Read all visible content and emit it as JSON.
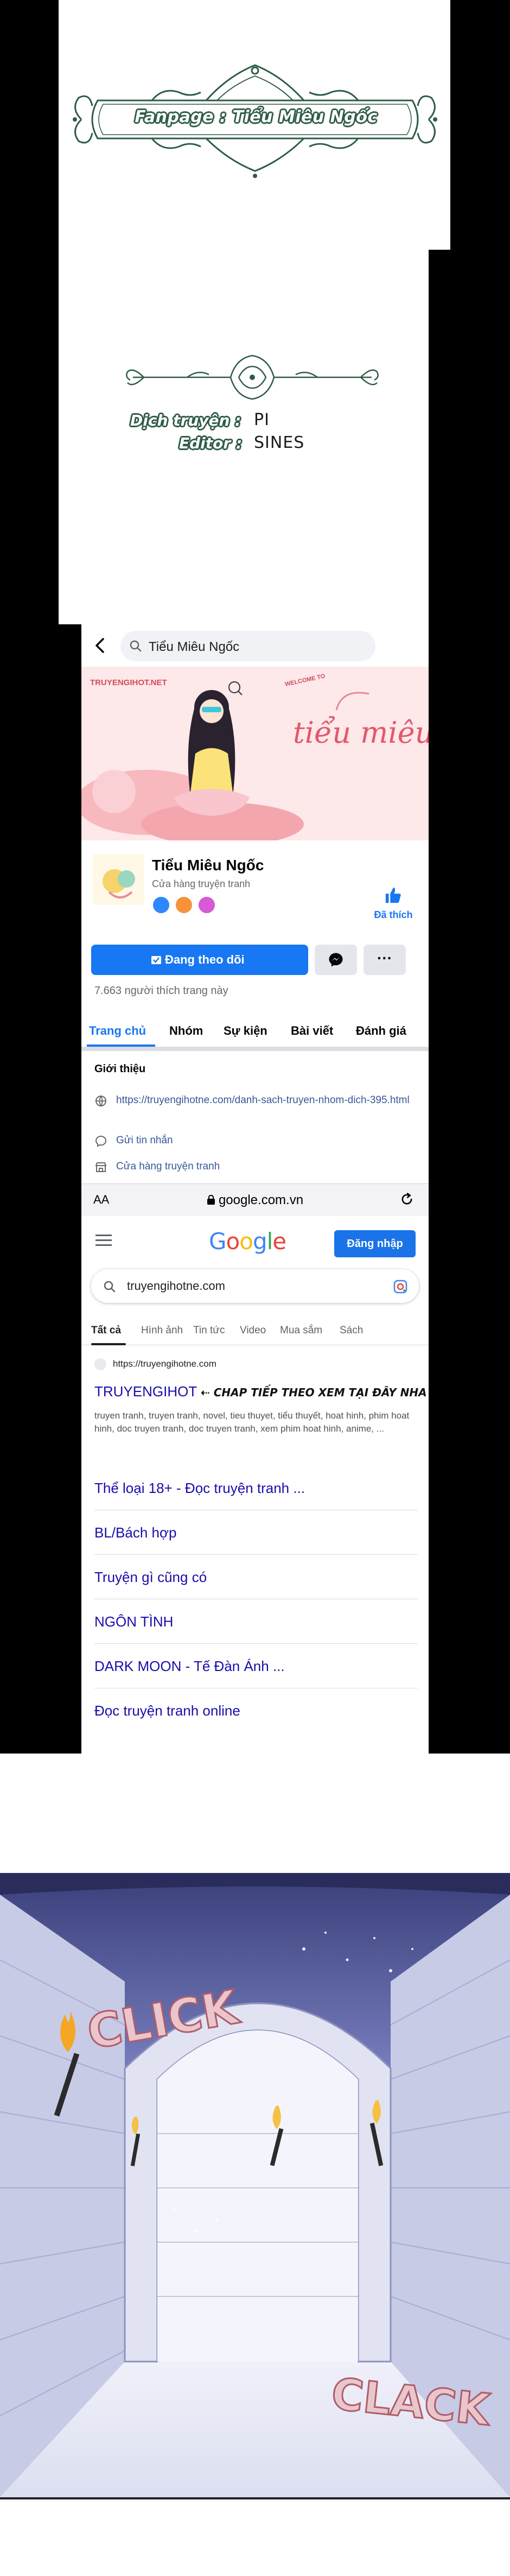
{
  "credits": {
    "fanpage_label": "Fanpage : Tiểu Miêu Ngốc",
    "translator_label": "Dịch truyện :",
    "translator_value": "PI",
    "editor_label": "Editor :",
    "editor_value": "SINES"
  },
  "facebook": {
    "search_query": "Tiểu Miêu Ngốc",
    "cover_brand": "TRUYENGIHOT.NET",
    "cover_welcome": "WELCOME TO",
    "cover_script": "tiểu miêu ngốc",
    "page_name": "Tiểu Miêu Ngốc",
    "page_category": "Cửa hàng truyện tranh",
    "liked_label": "Đã thích",
    "follow_label": "Đang theo dõi",
    "more_label": "···",
    "likes_count": "7.663 người thích trang này",
    "tabs": [
      "Trang chủ",
      "Nhóm",
      "Sự kiện",
      "Bài viết",
      "Đánh giá"
    ],
    "intro_title": "Giới thiệu",
    "intro_link": "https://truyengihotne.com/danh-sach-truyen-nhom-dich-395.html",
    "send_message": "Gửi tin nhắn",
    "shop_label": "Cửa hàng truyện tranh"
  },
  "safari": {
    "aa": "AA",
    "url": "google.com.vn",
    "lock_icon": "lock-icon",
    "reload_icon": "reload-icon"
  },
  "google": {
    "logo": "Google",
    "logo_colors": [
      "#4285F4",
      "#EA4335",
      "#FBBC05",
      "#4285F4",
      "#34A853",
      "#EA4335"
    ],
    "signin_label": "Đăng nhập",
    "query": "truyengihotne.com",
    "tabs": [
      "Tất cả",
      "Hình ảnh",
      "Tin tức",
      "Video",
      "Mua sắm",
      "Sách"
    ],
    "result_site": "https://truyengihotne.com",
    "result_title": "TRUYENGIHOT",
    "result_handwritten": "⇠ CHAP TIẾP THEO XEM TẠI ĐÂY NHA",
    "result_snippet": "truyen tranh, truyen tranh, novel, tieu thuyet, tiểu thuyết, hoat hinh, phim hoat hinh, doc truyen tranh, doc truyen tranh, xem phim hoat hinh, anime, ...",
    "sitelinks": [
      "Thể loại 18+ - Đọc truyện tranh ...",
      "BL/Bách hợp",
      "Truyện gì cũng có",
      "NGÔN TÌNH",
      "DARK MOON - Tế Đàn Ánh ...",
      "Đọc truyện tranh online"
    ]
  },
  "panel": {
    "sfx_1": "CLICK",
    "sfx_2": "CLACK"
  }
}
